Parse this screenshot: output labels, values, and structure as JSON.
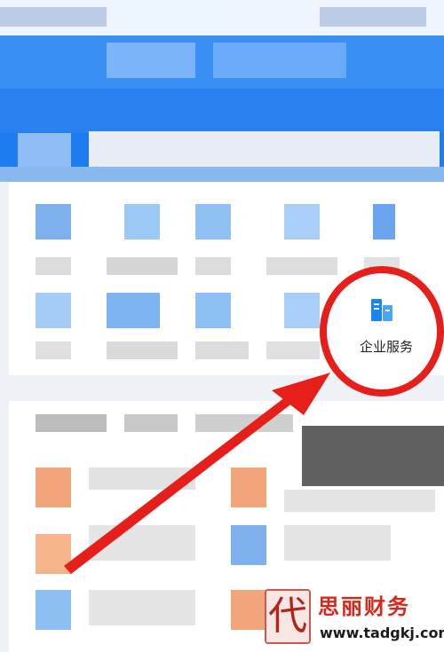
{
  "highlighted_item": {
    "label": "企业服务",
    "icon": "enterprise-building-icon"
  },
  "watermark": {
    "seal_char": "代",
    "brand": "思丽财务",
    "url": "www.tadgkj.com"
  },
  "colors": {
    "header_blue": "#1f7cf0",
    "highlight_red": "#e61f1a",
    "icon_blue": "#1b86ea",
    "brand_red": "#d8281c"
  }
}
